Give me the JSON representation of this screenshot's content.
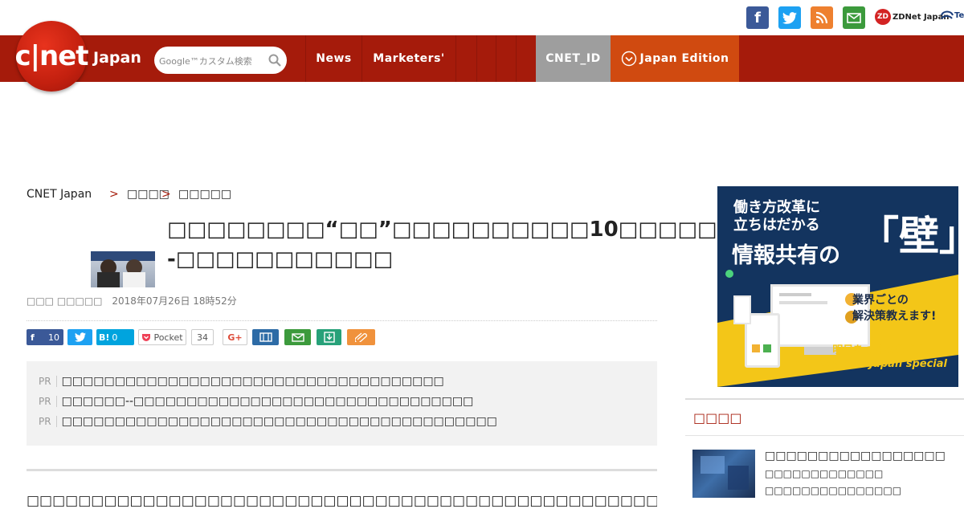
{
  "social": {
    "facebook": "f",
    "twitter": "t",
    "rss": "rss",
    "mail": "mail",
    "zdnet_label": "ZDNet Japan",
    "tech_label": "Te"
  },
  "header": {
    "logo": "c|net",
    "logo_sub": "Japan",
    "search_placeholder": "Google™カスタム検索",
    "nav": [
      "News",
      "Marketers'"
    ],
    "cnet_id": "CNET_ID",
    "edition": "Japan Edition"
  },
  "breadcrumb": [
    "CNET Japan",
    "□□□□",
    "□□□□□"
  ],
  "article": {
    "title": "□□□□□□□□“□□”□□□□□□□□□□10□□□□□--□□□□□□□□□□□",
    "byline": "□□□ □□□□□",
    "date": "2018年07月26日 18時52分"
  },
  "share": {
    "facebook_count": "10",
    "hatena_count": "0",
    "pocket_label": "Pocket",
    "pocket_count": "34",
    "gplus": "G+"
  },
  "pr": {
    "tag": "PR",
    "items": [
      "□□□□□□□□□□□□□□□□□□□□□□□□□□□□□□□□□□□□",
      "□□□□□□--□□□□□□□□□□□□□□□□□□□□□□□□□□□□□□□□",
      "□□□□□□□□□□□□□□□□□□□□□□□□□□□□□□□□□□□□□□□□□"
    ]
  },
  "body_text": "□□□□□□□□□□□□□□□□□□□□□□□□□□□□□□□□□□□□□□□□□□□□□□□□□□SNS education",
  "ad": {
    "line1": "働き方改革に",
    "line2": "立ちはだかる",
    "line3": "情報共有の",
    "big": "「壁」",
    "promo1": "業界ごとの",
    "promo2": "解決策教えます!",
    "footer1": "明日をつくる働き方改革",
    "footer2": "TechRepublic Japan special"
  },
  "sidebar": {
    "heading": "□□□□",
    "item_title": "□□□□□□□□□□□□□□□□□",
    "item_sub1": "□□□□□□□□□□□□□",
    "item_sub2": "□□□□□□□□□□□□□□□"
  },
  "colors": {
    "header_red": "#a51b0b",
    "edition_orange": "#d04a10",
    "cnet_id_gray": "#9e9e9e"
  }
}
